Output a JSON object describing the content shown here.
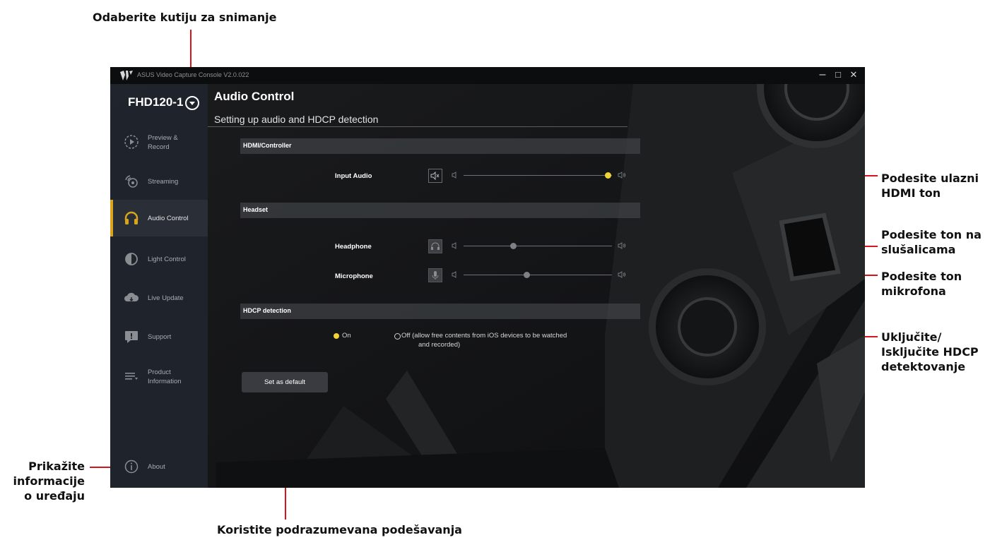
{
  "annotations": {
    "select_capture_box": "Odaberite kutiju za snimanje",
    "input_audio_line1": "Podesite ulazni",
    "input_audio_line2": "HDMI ton",
    "headphone_line1": "Podesite ton na",
    "headphone_line2": "slušalicama",
    "microphone_line1": "Podesite ton",
    "microphone_line2": "mikrofona",
    "hdcp_line1": "Uključite/",
    "hdcp_line2": "Isključite HDCP",
    "hdcp_line3": "detektovanje",
    "device_info_line1": "Prikažite",
    "device_info_line2": "informacije",
    "device_info_line3": "o uređaju",
    "use_defaults": "Koristite podrazumevana podešavanja"
  },
  "window": {
    "title": "ASUS Video Capture Console V2.0.022",
    "minimize_glyph": "–",
    "maximize_glyph": "□",
    "close_glyph": "✕"
  },
  "sidebar": {
    "device_name": "FHD120-1",
    "items": [
      {
        "label_line1": "Preview &",
        "label_line2": "Record",
        "icon": "play-circle-icon",
        "active": false
      },
      {
        "label_line1": "Streaming",
        "label_line2": "",
        "icon": "broadcast-icon",
        "active": false
      },
      {
        "label_line1": "Audio Control",
        "label_line2": "",
        "icon": "headphones-icon",
        "active": true
      },
      {
        "label_line1": "Light Control",
        "label_line2": "",
        "icon": "contrast-icon",
        "active": false
      },
      {
        "label_line1": "Live Update",
        "label_line2": "",
        "icon": "cloud-icon",
        "active": false
      },
      {
        "label_line1": "Support",
        "label_line2": "",
        "icon": "chat-icon",
        "active": false
      },
      {
        "label_line1": "Product",
        "label_line2": "Information",
        "icon": "list-icon",
        "active": false
      },
      {
        "label_line1": "About",
        "label_line2": "",
        "icon": "info-icon",
        "active": false
      }
    ]
  },
  "main": {
    "title": "Audio Control",
    "subtitle": "Setting up audio and HDCP detection",
    "sections": {
      "hdmi": "HDMI/Controller",
      "headset": "Headset",
      "hdcp": "HDCP detection"
    },
    "sliders": {
      "input_audio": {
        "label": "Input Audio",
        "value": 1.0
      },
      "headphone": {
        "label": "Headphone",
        "value": 0.33
      },
      "microphone": {
        "label": "Microphone",
        "value": 0.42
      }
    },
    "hdcp_options": {
      "on_label": "On",
      "off_label_line1": "Off  (allow free contents from iOS devices to be watched",
      "off_label_line2": "and recorded)",
      "selected": "on"
    },
    "default_button": "Set as default"
  },
  "colors": {
    "accent": "#d9a41c",
    "slider_active": "#f2d23b",
    "callout_line": "#d7141a"
  }
}
